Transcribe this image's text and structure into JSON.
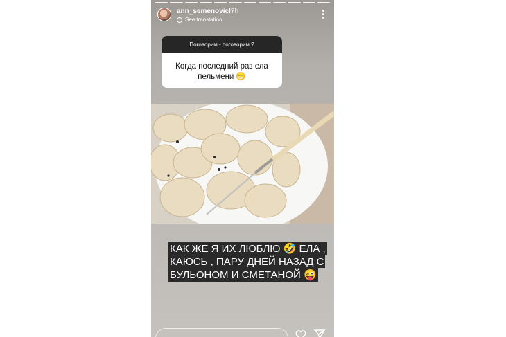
{
  "story": {
    "username": "ann_semenovich",
    "time": "7h",
    "translate_label": "See translation",
    "question_header": "Поговорим - поговорим ?",
    "question_text": "Когда последний раз ела пельмени 😁",
    "caption": "КАК ЖЕ Я ИХ ЛЮБЛЮ 🤣 ЕЛА , КАЮСЬ , ПАРУ ДНЕЙ НАЗАД С БУЛЬОНОМ И СМЕТАНОЙ 😜"
  },
  "icons": {
    "more": "more-vertical-icon",
    "globe": "globe-icon",
    "heart": "heart-icon",
    "send": "send-icon"
  }
}
